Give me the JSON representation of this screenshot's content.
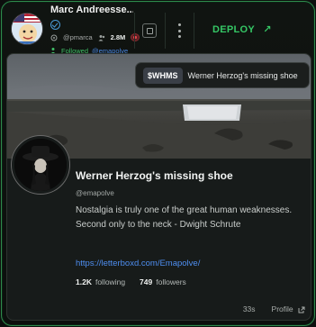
{
  "header": {
    "name": "Marc Andreesse...",
    "username": "@pmarca",
    "followers_count": "2.8M",
    "followed_label": "Followed",
    "followed_by_handle": "@emapolve",
    "deploy_label": "DEPLOY",
    "deploy_icon": "arrow-up-right-icon"
  },
  "token": {
    "ticker": "$WHMS",
    "name": "Werner Herzog's missing shoe"
  },
  "profile": {
    "display_name": "Werner Herzog's missing shoe",
    "handle": "@emapolve",
    "bio": "Nostalgia is truly one of the great human weaknesses. Second only to the neck - Dwight Schrute",
    "link": "https://letterboxd.com/Emapolve/",
    "following_count": "1.2K",
    "following_label": "following",
    "followers_count": "749",
    "followers_label": "followers"
  },
  "footer": {
    "time": "33s",
    "profile_label": "Profile"
  },
  "colors": {
    "accent_green": "#35c765",
    "border_green": "#2f8a4c",
    "link_blue": "#4e8ef0"
  }
}
